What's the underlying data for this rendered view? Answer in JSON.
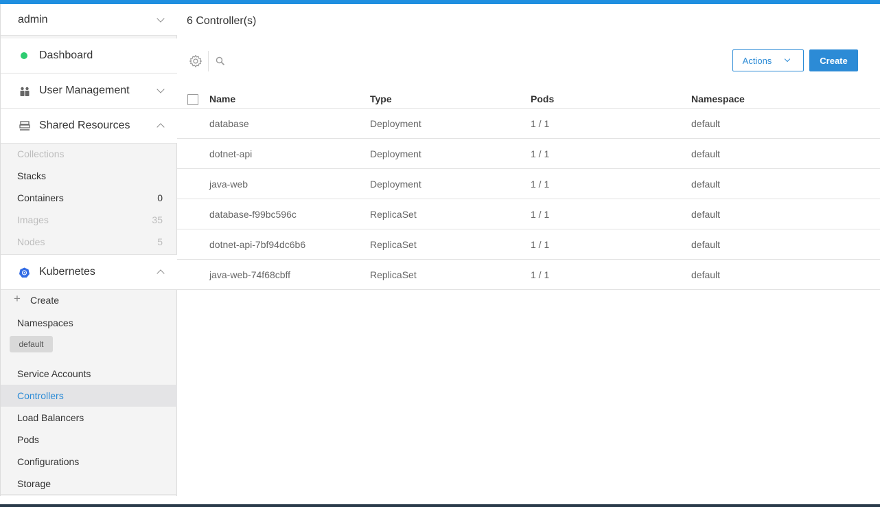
{
  "colors": {
    "accent": "#2c8bd6",
    "status_online": "#2ecc71",
    "topbar": "#1f8fe0"
  },
  "sidebar": {
    "user": "admin",
    "dashboard": "Dashboard",
    "user_management": "User Management",
    "shared_resources": "Shared Resources",
    "shared_items": [
      {
        "label": "Collections",
        "count": ""
      },
      {
        "label": "Stacks",
        "count": ""
      },
      {
        "label": "Containers",
        "count": "0"
      },
      {
        "label": "Images",
        "count": "35"
      },
      {
        "label": "Nodes",
        "count": "5"
      }
    ],
    "kubernetes": "Kubernetes",
    "create": "Create",
    "namespaces": "Namespaces",
    "namespace_selected": "default",
    "k8s_items": [
      {
        "label": "Service Accounts"
      },
      {
        "label": "Controllers"
      },
      {
        "label": "Load Balancers"
      },
      {
        "label": "Pods"
      },
      {
        "label": "Configurations"
      },
      {
        "label": "Storage"
      }
    ]
  },
  "main": {
    "title": "6 Controller(s)",
    "actions_label": "Actions",
    "create_label": "Create",
    "columns": [
      "Name",
      "Type",
      "Pods",
      "Namespace"
    ],
    "rows": [
      {
        "name": "database",
        "type": "Deployment",
        "pods": "1 / 1",
        "namespace": "default"
      },
      {
        "name": "dotnet-api",
        "type": "Deployment",
        "pods": "1 / 1",
        "namespace": "default"
      },
      {
        "name": "java-web",
        "type": "Deployment",
        "pods": "1 / 1",
        "namespace": "default"
      },
      {
        "name": "database-f99bc596c",
        "type": "ReplicaSet",
        "pods": "1 / 1",
        "namespace": "default"
      },
      {
        "name": "dotnet-api-7bf94dc6b6",
        "type": "ReplicaSet",
        "pods": "1 / 1",
        "namespace": "default"
      },
      {
        "name": "java-web-74f68cbff",
        "type": "ReplicaSet",
        "pods": "1 / 1",
        "namespace": "default"
      }
    ]
  }
}
